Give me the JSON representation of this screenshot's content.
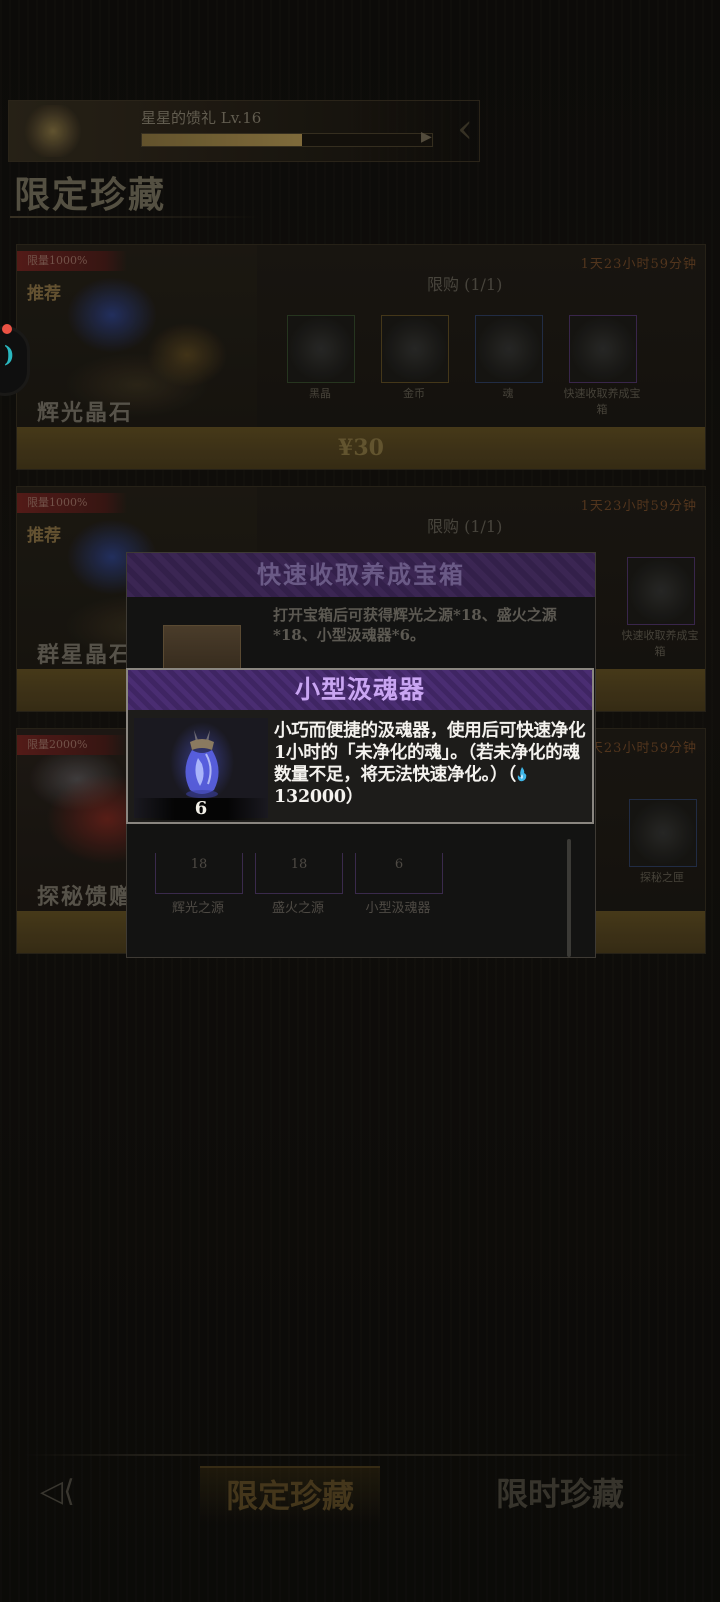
{
  "background": {
    "pass": {
      "title": "星星的馈礼 Lv.16",
      "progress": 0.55
    },
    "section_title": "限定珍藏",
    "cards": [
      {
        "tag": "限量1000%",
        "subtitle": "推荐",
        "name": "辉光晶石",
        "limit": "限购 (1/1)",
        "timer": "1天23小时59分钟",
        "price": "¥30",
        "slots": [
          {
            "label": "黑晶"
          },
          {
            "label": "金币"
          },
          {
            "label": "魂"
          },
          {
            "label": "快速收取养成宝箱"
          }
        ]
      },
      {
        "tag": "限量1000%",
        "subtitle": "推荐",
        "name": "群星晶石",
        "limit": "限购 (1/1)",
        "timer": "1天23小时59分钟",
        "slots": [
          {
            "label": "快速收取养成宝箱"
          }
        ]
      },
      {
        "tag": "限量2000%",
        "name": "探秘馈赠",
        "timer": "1天23小时59分钟",
        "slots": [
          {
            "label": "探秘之匣"
          }
        ]
      }
    ],
    "tabs": {
      "active": "限定珍藏",
      "inactive": "限时珍藏"
    }
  },
  "chest_panel": {
    "title": "快速收取养成宝箱",
    "description": "打开宝箱后可获得辉光之源*18、盛火之源*18、小型汲魂器*6。",
    "rewards": [
      {
        "count": "18",
        "name": "辉光之源"
      },
      {
        "count": "18",
        "name": "盛火之源"
      },
      {
        "count": "6",
        "name": "小型汲魂器"
      }
    ]
  },
  "tooltip": {
    "title": "小型汲魂器",
    "item_count": "6",
    "description_main": "小巧而便捷的汲魂器，使用后可快速净化1小时的「未净化的魂」。（若未净化的魂数量不足，将无法快速净化。）",
    "price_open": "（",
    "price_value": "132000",
    "price_close": "）"
  },
  "icons": {
    "soul_icon": "soul-flame-icon",
    "item_icon": "soul-absorber-icon",
    "back_icon": "back-arrow-icon"
  },
  "colors": {
    "tooltip_title": "#c9a5f2",
    "tooltip_header": "#4a2d72",
    "soul_icon": "#3fb6e8"
  }
}
